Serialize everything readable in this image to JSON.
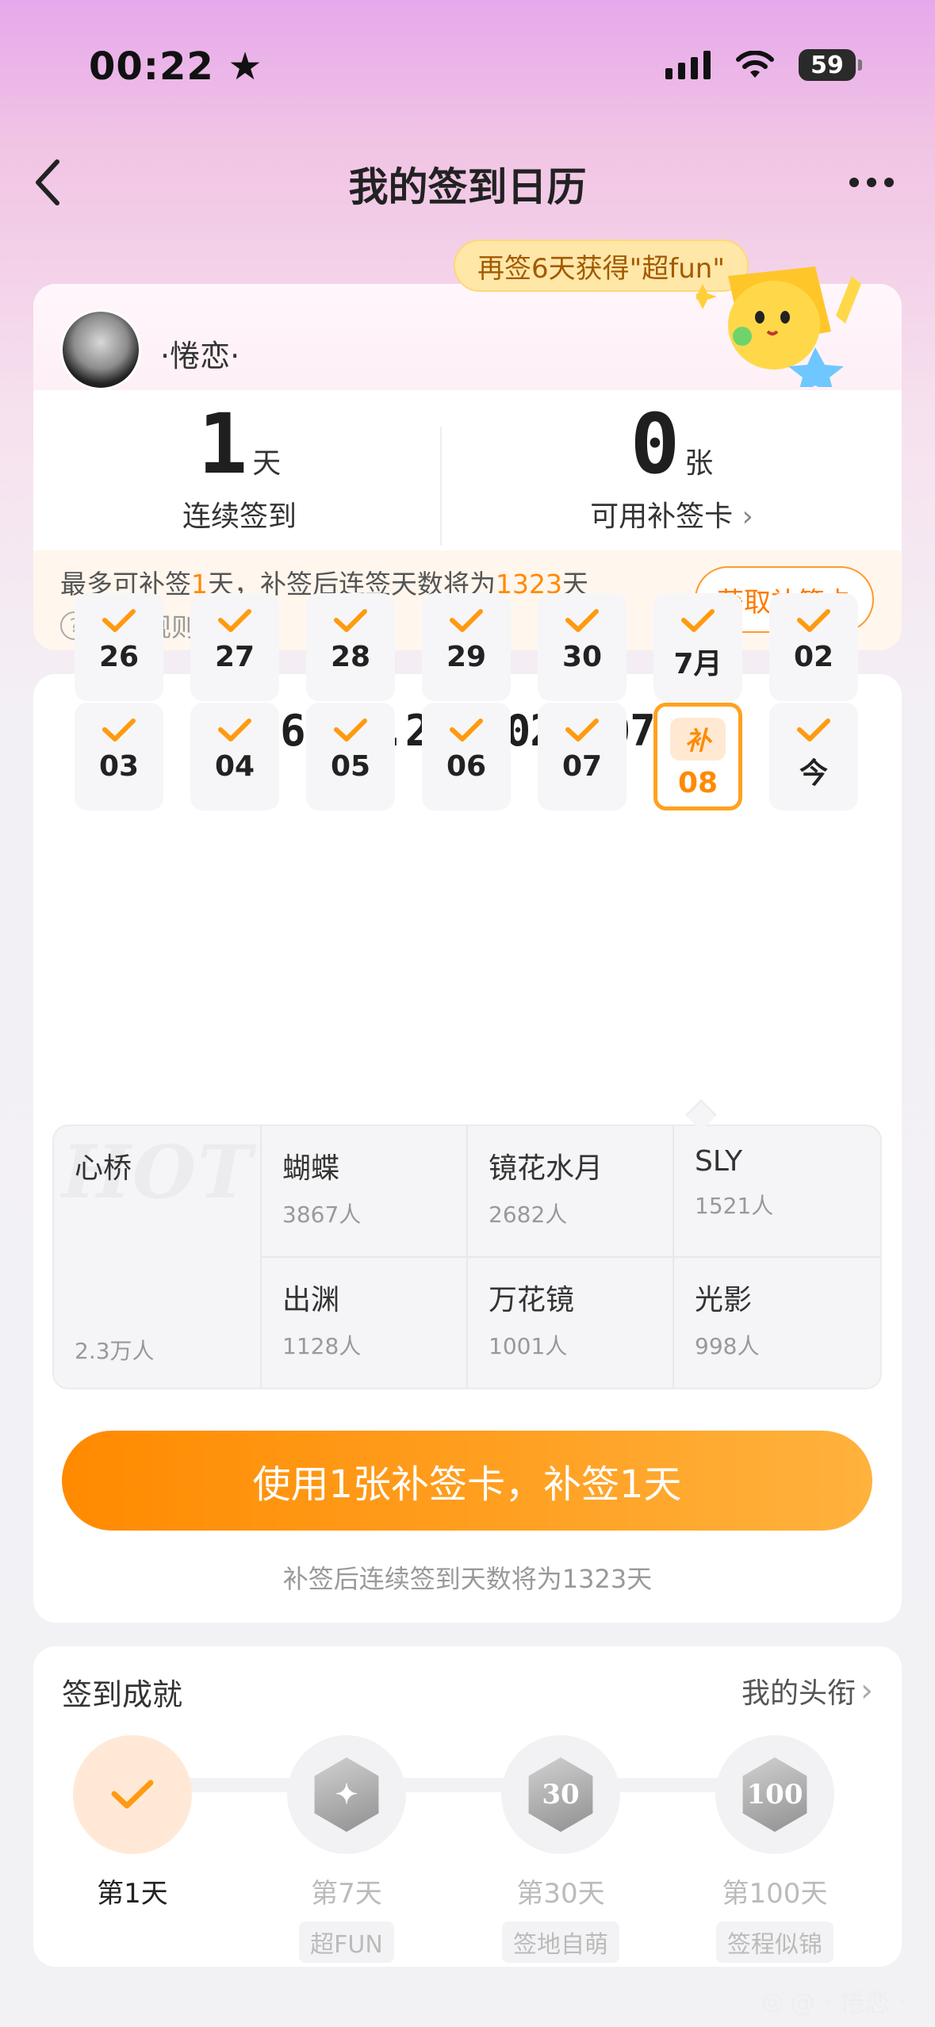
{
  "status_bar": {
    "time": "00:22",
    "battery": "59"
  },
  "header": {
    "title": "我的签到日历"
  },
  "profile": {
    "username": "·惓恋·",
    "bubble": "再签6天获得\"超fun\"",
    "streak_num": "1",
    "streak_unit": "天",
    "streak_label": "连续签到",
    "cards_num": "0",
    "cards_unit": "张",
    "cards_label": "可用补签卡",
    "makeup_prefix": "最多可补签",
    "makeup_days": "1",
    "makeup_middle": "天，补签后连签天数将为",
    "makeup_total": "1323",
    "makeup_suffix": "天",
    "rules_label": "补签规则",
    "rules_icon": "?",
    "get_card_button": "获取补签卡"
  },
  "calendar": {
    "range": "2026.06.26-2026.07.09",
    "days": [
      {
        "label": "26",
        "state": "checked"
      },
      {
        "label": "27",
        "state": "checked"
      },
      {
        "label": "28",
        "state": "checked"
      },
      {
        "label": "29",
        "state": "checked"
      },
      {
        "label": "30",
        "state": "checked"
      },
      {
        "label": "7月",
        "state": "checked"
      },
      {
        "label": "02",
        "state": "checked"
      },
      {
        "label": "03",
        "state": "checked"
      },
      {
        "label": "04",
        "state": "checked"
      },
      {
        "label": "05",
        "state": "checked"
      },
      {
        "label": "06",
        "state": "checked"
      },
      {
        "label": "07",
        "state": "checked"
      },
      {
        "label": "08",
        "state": "makeup",
        "badge": "补"
      },
      {
        "label": "今",
        "state": "checked"
      }
    ]
  },
  "ranking": {
    "hot_watermark": "HOT",
    "hot": {
      "name": "心桥",
      "count": "2.3万人"
    },
    "items": [
      {
        "name": "蝴蝶",
        "count": "3867人"
      },
      {
        "name": "镜花水月",
        "count": "2682人"
      },
      {
        "name": "SLY",
        "count": "1521人"
      },
      {
        "name": "出渊",
        "count": "1128人"
      },
      {
        "name": "万花镜",
        "count": "1001人"
      },
      {
        "name": "光影",
        "count": "998人"
      }
    ]
  },
  "makeup_action": {
    "button": "使用1张补签卡，补签1天",
    "note": "补签后连续签到天数将为1323天"
  },
  "achievements": {
    "title": "签到成就",
    "link": "我的头衔",
    "items": [
      {
        "label": "第1天",
        "tag": "",
        "badge": "",
        "done": true
      },
      {
        "label": "第7天",
        "tag": "超FUN",
        "badge": "",
        "done": false
      },
      {
        "label": "第30天",
        "tag": "签地自萌",
        "badge": "30",
        "done": false
      },
      {
        "label": "第100天",
        "tag": "签程似锦",
        "badge": "100",
        "done": false
      }
    ]
  },
  "watermark": {
    "text": "@ · 惓恋 ·"
  },
  "colors": {
    "accent": "#ff8a00",
    "accent_light": "#ffb23d"
  }
}
